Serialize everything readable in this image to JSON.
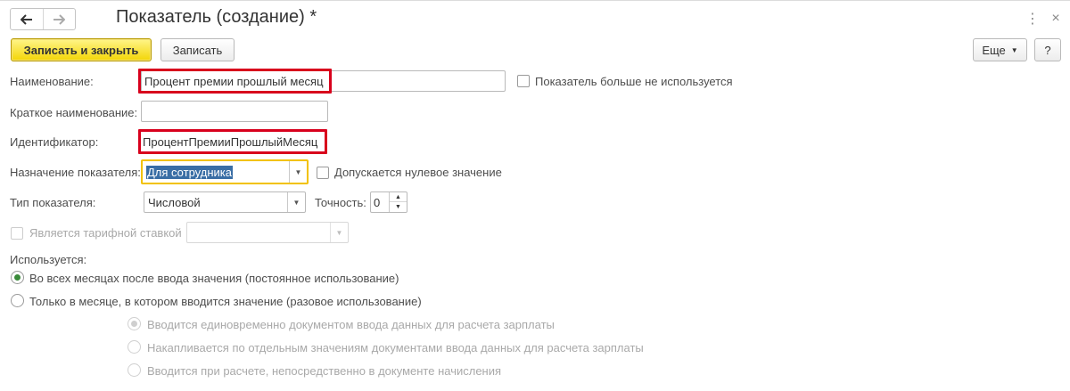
{
  "window": {
    "title": "Показатель (создание) *"
  },
  "toolbar": {
    "save_close_label": "Записать и закрыть",
    "save_label": "Записать",
    "more_label": "Еще",
    "help_label": "?"
  },
  "fields": {
    "name_label": "Наименование:",
    "name_value": "Процент премии прошлый месяц",
    "not_used_label": "Показатель больше не используется",
    "short_name_label": "Краткое наименование:",
    "short_name_value": "",
    "identifier_label": "Идентификатор:",
    "identifier_value": "ПроцентПремииПрошлыйМесяц",
    "purpose_label": "Назначение показателя:",
    "purpose_value": "Для сотрудника",
    "zero_allowed_label": "Допускается нулевое значение",
    "type_label": "Тип показателя:",
    "type_value": "Числовой",
    "precision_label": "Точность:",
    "precision_value": "0",
    "tariff_label": "Является тарифной ставкой",
    "tariff_value": ""
  },
  "usage": {
    "label": "Используется:",
    "options": [
      {
        "label": "Во всех месяцах после ввода значения (постоянное использование)",
        "selected": true
      },
      {
        "label": "Только в месяце, в котором вводится значение (разовое использование)",
        "selected": false
      }
    ],
    "sub_options": [
      {
        "label": "Вводится единовременно документом ввода данных для расчета зарплаты",
        "selected": true
      },
      {
        "label": "Накапливается по отдельным значениям документами ввода данных для расчета зарплаты",
        "selected": false
      },
      {
        "label": "Вводится при расчете, непосредственно в документе начисления",
        "selected": false
      }
    ]
  },
  "icons": [
    "back-arrow-icon",
    "forward-arrow-icon",
    "more-vertical-icon",
    "close-icon",
    "dropdown-arrow-icon",
    "spinner-up-icon",
    "spinner-down-icon"
  ],
  "colors": {
    "primary_button": "#f3d506",
    "highlight_box": "#d8001c",
    "focus_box": "#f2c200",
    "radio_selected": "#3a8a3a"
  }
}
